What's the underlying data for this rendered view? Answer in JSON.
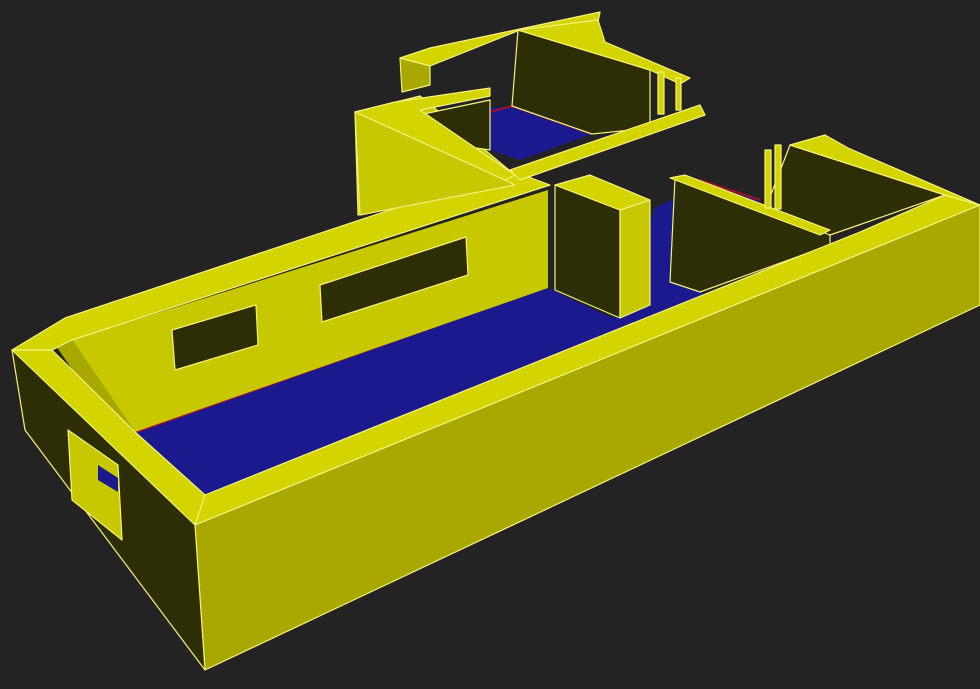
{
  "scene": {
    "description_kind": "3d-floor-plan-render",
    "colors": {
      "background": "#232323",
      "wall_top": "#d4d400",
      "wall_light": "#c8c800",
      "wall_mid": "#a8a800",
      "wall_dark": "#2e2e06",
      "wall_edge": "#f4f27a",
      "floor": "#1a1a8e",
      "floor_trim": "#a0102a"
    }
  }
}
